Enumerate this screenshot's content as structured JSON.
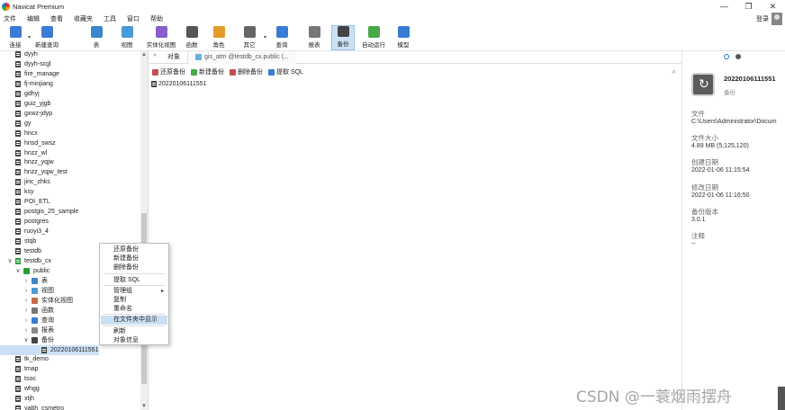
{
  "window": {
    "title": "Navicat Premium",
    "controls": [
      "—",
      "❐",
      "✕"
    ]
  },
  "menu": [
    "文件",
    "编辑",
    "查看",
    "收藏夹",
    "工具",
    "窗口",
    "帮助"
  ],
  "login_label": "登录",
  "toolbar": [
    {
      "label": "连接",
      "icon": "connect-icon",
      "color": "#3a7bd5",
      "dropdown": true
    },
    {
      "label": "新建查询",
      "icon": "new-query-icon",
      "color": "#3a7bd5"
    },
    {
      "label": "表",
      "icon": "table-icon",
      "color": "#3a86c8"
    },
    {
      "label": "视图",
      "icon": "view-icon",
      "color": "#4a9ad8"
    },
    {
      "label": "实体化视图",
      "icon": "materialized-view-icon",
      "color": "#8a5fc7"
    },
    {
      "label": "函数",
      "icon": "function-icon",
      "color": "#555555"
    },
    {
      "label": "角色",
      "icon": "role-icon",
      "color": "#e59a2a"
    },
    {
      "label": "其它",
      "icon": "other-icon",
      "color": "#666666",
      "dropdown": true
    },
    {
      "label": "查询",
      "icon": "query-icon",
      "color": "#3a7bd5"
    },
    {
      "label": "报表",
      "icon": "report-icon",
      "color": "#777777"
    },
    {
      "label": "备份",
      "icon": "backup-icon",
      "color": "#444444",
      "active": true
    },
    {
      "label": "自动运行",
      "icon": "automation-icon",
      "color": "#4aa84a"
    },
    {
      "label": "模型",
      "icon": "model-icon",
      "color": "#3a7bd5"
    }
  ],
  "tree": [
    {
      "label": "dyyh",
      "type": "db"
    },
    {
      "label": "dyyh-scgl",
      "type": "db"
    },
    {
      "label": "fire_manage",
      "type": "db"
    },
    {
      "label": "fj-minjiang",
      "type": "db"
    },
    {
      "label": "gdhyj",
      "type": "db"
    },
    {
      "label": "guiz_yjgb",
      "type": "db"
    },
    {
      "label": "gxwz-jdyp",
      "type": "db"
    },
    {
      "label": "gy",
      "type": "db"
    },
    {
      "label": "hncx",
      "type": "db"
    },
    {
      "label": "hnsd_swsz",
      "type": "db"
    },
    {
      "label": "hnzz_wl",
      "type": "db"
    },
    {
      "label": "hnzz_yqjw",
      "type": "db"
    },
    {
      "label": "hnzz_yqjw_test",
      "type": "db"
    },
    {
      "label": "jinc_zhks",
      "type": "db"
    },
    {
      "label": "ksy",
      "type": "db"
    },
    {
      "label": "POI_ETL",
      "type": "db"
    },
    {
      "label": "postgis_25_sample",
      "type": "db"
    },
    {
      "label": "postgres",
      "type": "db"
    },
    {
      "label": "ruoyi3_4",
      "type": "db"
    },
    {
      "label": "stqb",
      "type": "db"
    },
    {
      "label": "testdb",
      "type": "db"
    },
    {
      "label": "testdb_cx",
      "type": "db-open",
      "arrow": "∨"
    },
    {
      "label": "public",
      "type": "schema",
      "arrow": "∨",
      "indent": 1
    },
    {
      "label": "表",
      "type": "folder",
      "arrow": "›",
      "indent": 2,
      "color": "#3a86c8"
    },
    {
      "label": "视图",
      "type": "folder",
      "arrow": "›",
      "indent": 2,
      "color": "#4a9ad8"
    },
    {
      "label": "实体化视图",
      "type": "folder",
      "arrow": "›",
      "indent": 2,
      "color": "#c86a4a"
    },
    {
      "label": "函数",
      "type": "folder",
      "arrow": "›",
      "indent": 2,
      "color": "#777777"
    },
    {
      "label": "查询",
      "type": "folder",
      "arrow": "›",
      "indent": 2,
      "color": "#3a7bd5"
    },
    {
      "label": "报表",
      "type": "folder",
      "arrow": "›",
      "indent": 2,
      "color": "#888888"
    },
    {
      "label": "备份",
      "type": "folder",
      "arrow": "∨",
      "indent": 2,
      "color": "#444444"
    },
    {
      "label": "20220106111551",
      "type": "backup",
      "indent": 3,
      "selected": true
    },
    {
      "label": "tk_demo",
      "type": "db"
    },
    {
      "label": "tmap",
      "type": "db"
    },
    {
      "label": "tsoc",
      "type": "db"
    },
    {
      "label": "whgg",
      "type": "db"
    },
    {
      "label": "xtjh",
      "type": "db"
    },
    {
      "label": "yabh_csmetro",
      "type": "db"
    }
  ],
  "context_menu": [
    {
      "label": "还原备份"
    },
    {
      "label": "新建备份"
    },
    {
      "label": "删除备份"
    },
    {
      "sep": true
    },
    {
      "label": "提取 SQL"
    },
    {
      "sep": true
    },
    {
      "label": "管理组",
      "submenu": true
    },
    {
      "label": "复制"
    },
    {
      "label": "重命名"
    },
    {
      "sep": true
    },
    {
      "label": "在文件夹中显示",
      "highlight": true
    },
    {
      "sep": true
    },
    {
      "label": "刷新"
    },
    {
      "label": "对象信息"
    }
  ],
  "tabs": {
    "objects": "对象",
    "active": "gis_atm @testdb_cx.public (..."
  },
  "subtoolbar": [
    {
      "label": "还原备份",
      "color": "#c0504d"
    },
    {
      "label": "新建备份",
      "color": "#4aa84a"
    },
    {
      "label": "删除备份",
      "color": "#c0504d"
    },
    {
      "label": "提取 SQL",
      "color": "#3a7bd5"
    }
  ],
  "backup_item": "20220106111551",
  "info": {
    "name": "20220106111551",
    "kind": "备份",
    "fields": [
      {
        "label": "文件",
        "value": "C:\\Users\\Administrator\\Docum"
      },
      {
        "label": "文件大小",
        "value": "4.89 MB (5,125,120)"
      },
      {
        "label": "创建日期",
        "value": "2022-01-06 11:15:54"
      },
      {
        "label": "修改日期",
        "value": "2022-01-06 11:16:50"
      },
      {
        "label": "备份版本",
        "value": "3.0.1"
      },
      {
        "label": "注释",
        "value": "--"
      }
    ]
  },
  "watermark": "CSDN @一蓑烟雨摆舟"
}
